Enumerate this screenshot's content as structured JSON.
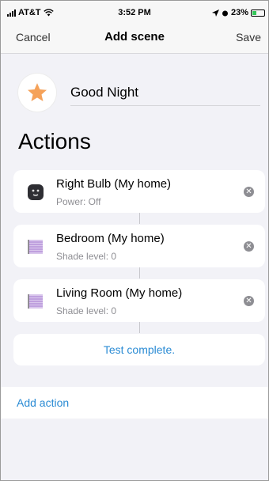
{
  "status_bar": {
    "carrier": "AT&T",
    "time": "3:52 PM",
    "battery": "23%"
  },
  "nav": {
    "cancel_label": "Cancel",
    "title": "Add scene",
    "save_label": "Save"
  },
  "scene": {
    "icon": "star-icon",
    "name": "Good Night"
  },
  "section_title": "Actions",
  "actions": [
    {
      "name": "Right Bulb (My home)",
      "detail": "Power: Off",
      "icon": "plug-icon"
    },
    {
      "name": "Bedroom (My home)",
      "detail": "Shade level: 0",
      "icon": "shade-icon"
    },
    {
      "name": "Living Room (My home)",
      "detail": "Shade level: 0",
      "icon": "shade-icon"
    }
  ],
  "test_label": "Test complete.",
  "add_action_label": "Add action",
  "colors": {
    "accent": "#2a8bd4",
    "star": "#f5a25a",
    "shade": "#b79ad6"
  }
}
